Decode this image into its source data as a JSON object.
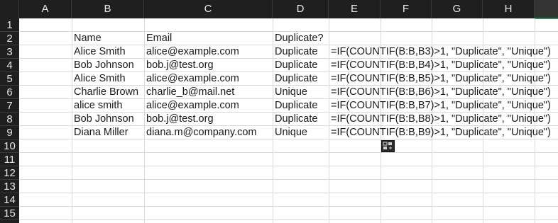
{
  "columns": [
    "A",
    "B",
    "C",
    "D",
    "E",
    "F",
    "G",
    "H"
  ],
  "rows": [
    "1",
    "2",
    "3",
    "4",
    "5",
    "6",
    "7",
    "8",
    "9",
    "10",
    "11",
    "12",
    "13",
    "14",
    "15"
  ],
  "headers": {
    "name": "Name",
    "email": "Email",
    "duplicate": "Duplicate?"
  },
  "data": [
    {
      "name": "Alice Smith",
      "email": "alice@example.com",
      "dup": "Duplicate",
      "formula": "=IF(COUNTIF(B:B,B3)>1, \"Duplicate\", \"Unique\")"
    },
    {
      "name": "Bob Johnson",
      "email": "bob.j@test.org",
      "dup": "Duplicate",
      "formula": "=IF(COUNTIF(B:B,B4)>1, \"Duplicate\", \"Unique\")"
    },
    {
      "name": "Alice Smith",
      "email": "alice@example.com",
      "dup": "Duplicate",
      "formula": "=IF(COUNTIF(B:B,B5)>1, \"Duplicate\", \"Unique\")"
    },
    {
      "name": "Charlie Brown",
      "email": "charlie_b@mail.net",
      "dup": "Unique",
      "formula": "=IF(COUNTIF(B:B,B6)>1, \"Duplicate\", \"Unique\")"
    },
    {
      "name": "alice smith",
      "email": "alice@example.com",
      "dup": "Duplicate",
      "formula": "=IF(COUNTIF(B:B,B7)>1, \"Duplicate\", \"Unique\")"
    },
    {
      "name": "Bob Johnson",
      "email": "bob.j@test.org",
      "dup": "Duplicate",
      "formula": "=IF(COUNTIF(B:B,B8)>1, \"Duplicate\", \"Unique\")"
    },
    {
      "name": "Diana Miller",
      "email": "diana.m@company.com",
      "dup": "Unique",
      "formula": "=IF(COUNTIF(B:B,B9)>1, \"Duplicate\", \"Unique\")"
    }
  ],
  "quick_analysis": {
    "icon": "quick-analysis-icon"
  },
  "colors": {
    "header_bg": "#1f1f1f",
    "header_text": "#e6e6e6",
    "gridline": "#d9d9d9",
    "accent": "#2e8b57"
  }
}
